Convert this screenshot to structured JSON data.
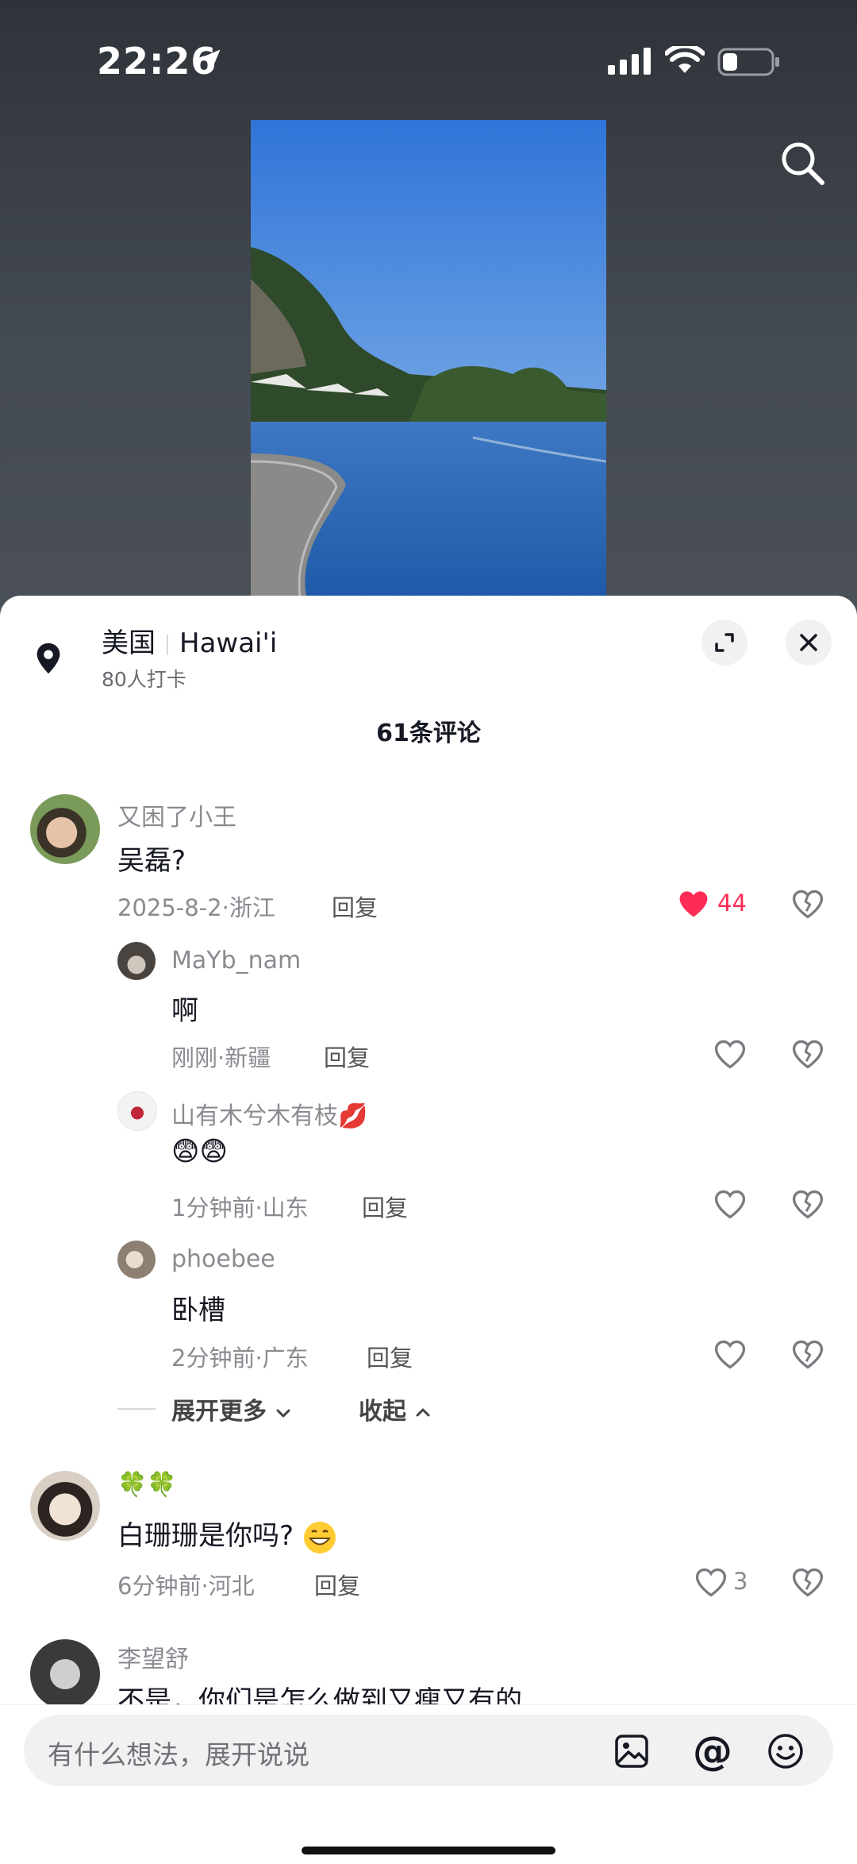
{
  "status": {
    "time": "22:26"
  },
  "location": {
    "country": "美国",
    "place": "Hawai'i",
    "checkins": "80人打卡"
  },
  "comments_header": {
    "count_label": "61条评论"
  },
  "comments": [
    {
      "user": "又困了小王",
      "text": "吴磊?",
      "date": "2025-8-2",
      "region": "浙江",
      "reply_label": "回复",
      "likes": "44",
      "liked": true
    },
    {
      "user": "MaYb_nam",
      "text": "啊",
      "date": "刚刚",
      "region": "新疆",
      "reply_label": "回复"
    },
    {
      "user": "山有木兮木有枝💋",
      "text": "😨😨",
      "date": "1分钟前",
      "region": "山东",
      "reply_label": "回复"
    },
    {
      "user": "phoebee",
      "text": "卧槽",
      "date": "2分钟前",
      "region": "广东",
      "reply_label": "回复"
    },
    {
      "user": "🍀🍀",
      "text": "白珊珊是你吗?",
      "date": "6分钟前",
      "region": "河北",
      "reply_label": "回复",
      "likes": "3"
    },
    {
      "user": "李望舒",
      "text": "不是，你们是怎么做到又瘦又有的"
    }
  ],
  "thread": {
    "expand_more": "展开更多",
    "collapse": "收起"
  },
  "meta_separator": "·",
  "input": {
    "placeholder": "有什么想法，展开说说"
  },
  "icons": [
    "location-arrow-icon",
    "signal-icon",
    "wifi-icon",
    "battery-icon",
    "search-icon",
    "map-pin-icon",
    "expand-icon",
    "close-icon",
    "heart-icon",
    "dislike-icon",
    "chevron-down-icon",
    "chevron-up-icon",
    "image-icon",
    "at-icon",
    "emoji-icon"
  ],
  "colors": {
    "accent": "#fe2c55",
    "sheet_bg": "#ffffff",
    "backdrop": "#444a52"
  }
}
